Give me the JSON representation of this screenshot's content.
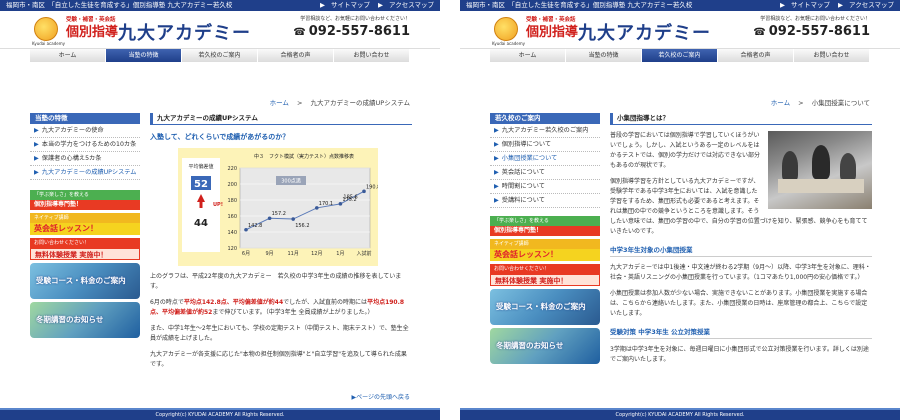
{
  "common": {
    "topbar_text": "福岡市・南区　「自立した生徒を育成する」個別指導塾 九大アカデミー若久校",
    "sitemap": "サイトマップ",
    "access": "アクセスマップ",
    "logo_small": "Kyudai academy",
    "logo_sub": "受験・補習・英会話",
    "logo_main": "個別指導",
    "logo_brand": "九大アカデミー",
    "header_info": "学習相談など、お気軽にお問い合わせください！",
    "tel": "092-557-8611",
    "copyright": "Copyright(c) KYUDAI ACADEMY All Rights Reserved.",
    "colors": {
      "primary": "#1f3f8a",
      "accent_red": "#d0201c",
      "link": "#1f5fb0",
      "chart_bg": "#fdf3b8"
    }
  },
  "site_a": {
    "nav": [
      "ホーム",
      "当塾の特徴",
      "若久校のご案内",
      "合格者の声",
      "お問い合わせ"
    ],
    "active_nav": 1,
    "crumb_home": "ホーム",
    "crumb_sep": ">",
    "crumb_current": "九大アカデミーの成績UPシステム",
    "side_head": "当塾の特徴",
    "side_items": [
      "九大アカデミーの使命",
      "本当の学力をつけるための10カ条",
      "保護者の心構え5カ条",
      "九大アカデミーの成績UPシステム"
    ],
    "banners": {
      "b1": "「学ぶ楽しさ」を教える",
      "b2": "個別指導専門塾！",
      "b3": "ネイティブ講師",
      "b4": "英会話レッスン！",
      "b5": "お問い合わせください！",
      "b6": "無料体験授業 実施中！",
      "p1": "受験コース・料金のご案内",
      "p2": "冬期講習のお知らせ"
    },
    "main_title": "九大アカデミーの成績UPシステム",
    "lead": "入塾して、どれくらいで成績があがるのか？",
    "deviation_label": "平均偏差値",
    "deviation_top": "52",
    "up_label": "UP!",
    "deviation_bottom": "44",
    "para1": "上のグラフは、平成22年度の九大アカデミー　若久校の中学3年生の成績の推移を表しています。",
    "para2_a": "6月の時点で",
    "para2_b": "平均点142.8点、平均偏差値が約44",
    "para2_c": "でしたが、入試直前の時期には",
    "para2_d": "平均点190.8点、平均偏差値が約52",
    "para2_e": "まで伸びています。（中学3年生 全員成績が上がりました。）",
    "para3": "また、中学1年生～2年生においても、学校の定期テスト（中間テスト、期末テスト）で、塾生全員が成績を上げました。",
    "para4": "九大アカデミーが各支援に応じた\"本物の担任制個別指導\"と\"自立学習\"を追及して導られた成果です。",
    "pagetop": "ページの先頭へ戻る"
  },
  "chart_data": {
    "type": "line",
    "title": "中３　フクト模試（実力テスト）点数推移表",
    "annotation": "300点満",
    "categories": [
      "6月",
      "9月",
      "11月",
      "12月",
      "1月",
      "入試前"
    ],
    "series": [
      {
        "values": [
          142.8,
          157.2,
          156.2,
          170.1,
          175.2,
          190.8
        ]
      }
    ],
    "data_labels": [
      "142.8",
      "157.2",
      "156.2",
      "170.1",
      "175.2",
      "190.8"
    ],
    "extra_label": "185.6",
    "ylim": [
      120,
      220
    ],
    "yticks": [
      120,
      140,
      160,
      180,
      200,
      220
    ],
    "grid": true
  },
  "site_b": {
    "nav": [
      "ホーム",
      "当塾の特徴",
      "若久校のご案内",
      "合格者の声",
      "お問い合わせ"
    ],
    "active_nav": 2,
    "crumb_home": "ホーム",
    "crumb_sep": ">",
    "crumb_current": "小集団授業について",
    "side_head": "若久校のご案内",
    "side_items": [
      "九大アカデミー若久校のご案内",
      "個別指導について",
      "小集団授業について",
      "英会話について",
      "時間割について",
      "受講料について"
    ],
    "main_title": "小集団指導とは？",
    "p1": "普段の学習においては個別指導で学習していくほうがいいでしょう。しかし、入試というある一定のレベルをはかるテストでは、個別の学力だけでは対応できない部分もあるのが現状です。",
    "p2": "個別指導学習を方針としている九大アカデミーですが、受験学年である中学3年生においては、入試を意識した学習をするため、集団形式も必要であると考えます。それは集団の中での競争というところを意識します。そうしたい意味では、集団の学習の中で、自分の学習の位置づけを知り、緊張感、競争心をも育てていきたいのです。",
    "sub1": "中学3年生対象の小集団授業",
    "p3": "九大アカデミーでは中1後達・中文達が終わる2学期（9月～）以降、中学3年生を対象に、理科・社会・英語リスニングの小集団授業を行っています。（1コマあたり1,000円の安心価格です。）",
    "p4": "小集団授業は参加人数が少ない場合、実施できないことがあります。小集団授業を実施する場合は、こちらから連絡いたします。また、小集団授業の日時は、座席管理の都合上、こちらで設定いたします。",
    "sub2": "受験対策 中学3年生 公立対策授業",
    "p5": "3学期は中学3年生を対象に、毎週日曜日に小集団形式で公立対策授業を行います。詳しくは別途でご案内いたします。"
  }
}
